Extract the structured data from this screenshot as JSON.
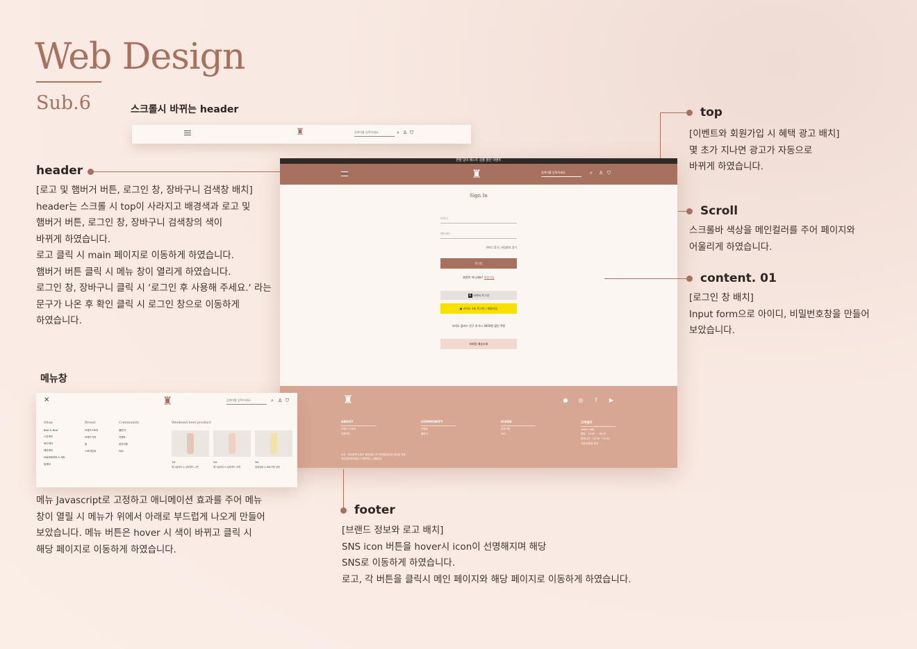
{
  "colors": {
    "accent": "#a8705f",
    "footer": "#d8a794",
    "background": "#fbeee7",
    "kakao": "#f9e000",
    "topbar": "#2f2a28"
  },
  "title": "Web Design",
  "subtitle": "Sub.6",
  "scroll_header_caption": "스크롤시 바뀌는 header",
  "header_section": {
    "title": "header",
    "desc": "[로고 및 햄버거 버튼, 로그인 창, 장바구니 검색창 배치]\nheader는 스크롤 시 top이 사라지고 배경색과 로고 및\n햄버거 버튼, 로그인 창, 장바구니 검색창의 색이\n바뀌게 하였습니다.\n로고 클릭 시 main 페이지로 이동하게 하였습니다.\n햄버거 버튼 클릭 시 메뉴 창이 열리게 하였습니다.\n로그인 창, 장바구니 클릭 시 ‘로그인 후 사용해 주세요.‘ 라는\n문구가 나온 후 확인 클릭 시 로그인 창으로 이동하게\n하였습니다."
  },
  "top_section": {
    "title": "top",
    "desc": "[이벤트와 회원가입 시 혜택 광고 배치]\n몇 초가 지나면 광고가 자동으로\n바뀌게 하였습니다."
  },
  "scroll_section": {
    "title": "Scroll",
    "desc": "스크롤바 색상을 메인컬러를 주어 페이지와\n어울리게 하였습니다."
  },
  "content_section": {
    "title": "content. 01",
    "desc": "[로그인 창 배치]\nInput form으로 아이디, 비밀번호창을 만들어\n보았습니다."
  },
  "menu_section": {
    "title": "메뉴창",
    "desc": "메뉴 Javascript로 고정하고 애니메이션 효과를 주어 메뉴\n창이 열릴 시 메뉴가 위에서 아래로 부드럽게 나오게 만들어\n보았습니다. 메뉴 버튼은  hover 시 색이 바뀌고 클릭 시\n해당 페이지로 이동하게 하였습니다."
  },
  "footer_section": {
    "title": "footer",
    "desc": "[브랜드 정보와 로고 배치]\nSNS icon 버튼을 hover시 icon이 선명해지며 해당\nSNS로 이동하게 하였습니다.\n로고, 각 버튼을  클릭시 메인 페이지와 해당 페이지로 이동하게 하였습니다."
  },
  "mockup": {
    "topbar_text": "연말 맞이 베스트 상품 할인 이벤트",
    "search_placeholder": "검색어를 입력하세요.",
    "signin_title": "Sign In",
    "id_placeholder": "아이디",
    "pw_placeholder": "패스워드",
    "find_id": "아이디 찾기",
    "find_pw": "비밀번호 찾기",
    "login_button": "로그인",
    "join_prompt": "회원이 아니세요?",
    "join_link": "회원가입",
    "naver_button": "네이버 로그인",
    "kakao_button": "카카오 1초 로그인 / 회원가입",
    "kakao_note": "카카오 플러스 친구 추가시 3000원 할인 쿠폰",
    "guest_button": "비회원 배송조회",
    "footer": {
      "columns": [
        {
          "head": "ABOUT",
          "items": [
            "브랜드 스토리",
            "이용약관"
          ]
        },
        {
          "head": "COMMUNITY",
          "items": [
            "이벤트",
            "챌린지"
          ]
        },
        {
          "head": "GUIDE",
          "items": [
            "공지사항",
            "FAQ"
          ]
        },
        {
          "head": "고객센터",
          "items": [
            "1688-1688",
            "평일 : 10:00 ~ 18:00",
            "휴게시간 : 12:30 ~13:30",
            "주말/공휴일 휴무"
          ]
        }
      ],
      "address": "주소 : 부산광역시 중구 중앙대로 2F 다온빵집/대표 정다온 번호",
      "policy": "개인정보처리방침 | 이용약관 | 이용안내"
    }
  },
  "menu_panel": {
    "search_placeholder": "검색어를 입력하세요.",
    "shop_head": "Shop",
    "shop_items": [
      "Best & New",
      "스킨케어",
      "바디케어",
      "헤어케어",
      "아로마테라피 & 세트",
      "립케어"
    ],
    "bread_head": "Bread",
    "bread_items": [
      "브랜드스토리",
      "브랜드가치",
      "팀",
      "스토어안내"
    ],
    "community_head": "Community",
    "community_items": [
      "챌린지",
      "이벤트",
      "공지사항",
      "FAQ"
    ],
    "best_head": "Weekend best product",
    "products": [
      {
        "rank": "1st",
        "name": "에그슬러리 & 샴푸앤드 시즌"
      },
      {
        "rank": "2st",
        "name": "에그슬러리 & 샴푸앤드 포켓"
      },
      {
        "rank": "3st",
        "name": "일랑일랑 & 베르가못 샴푸"
      }
    ]
  }
}
